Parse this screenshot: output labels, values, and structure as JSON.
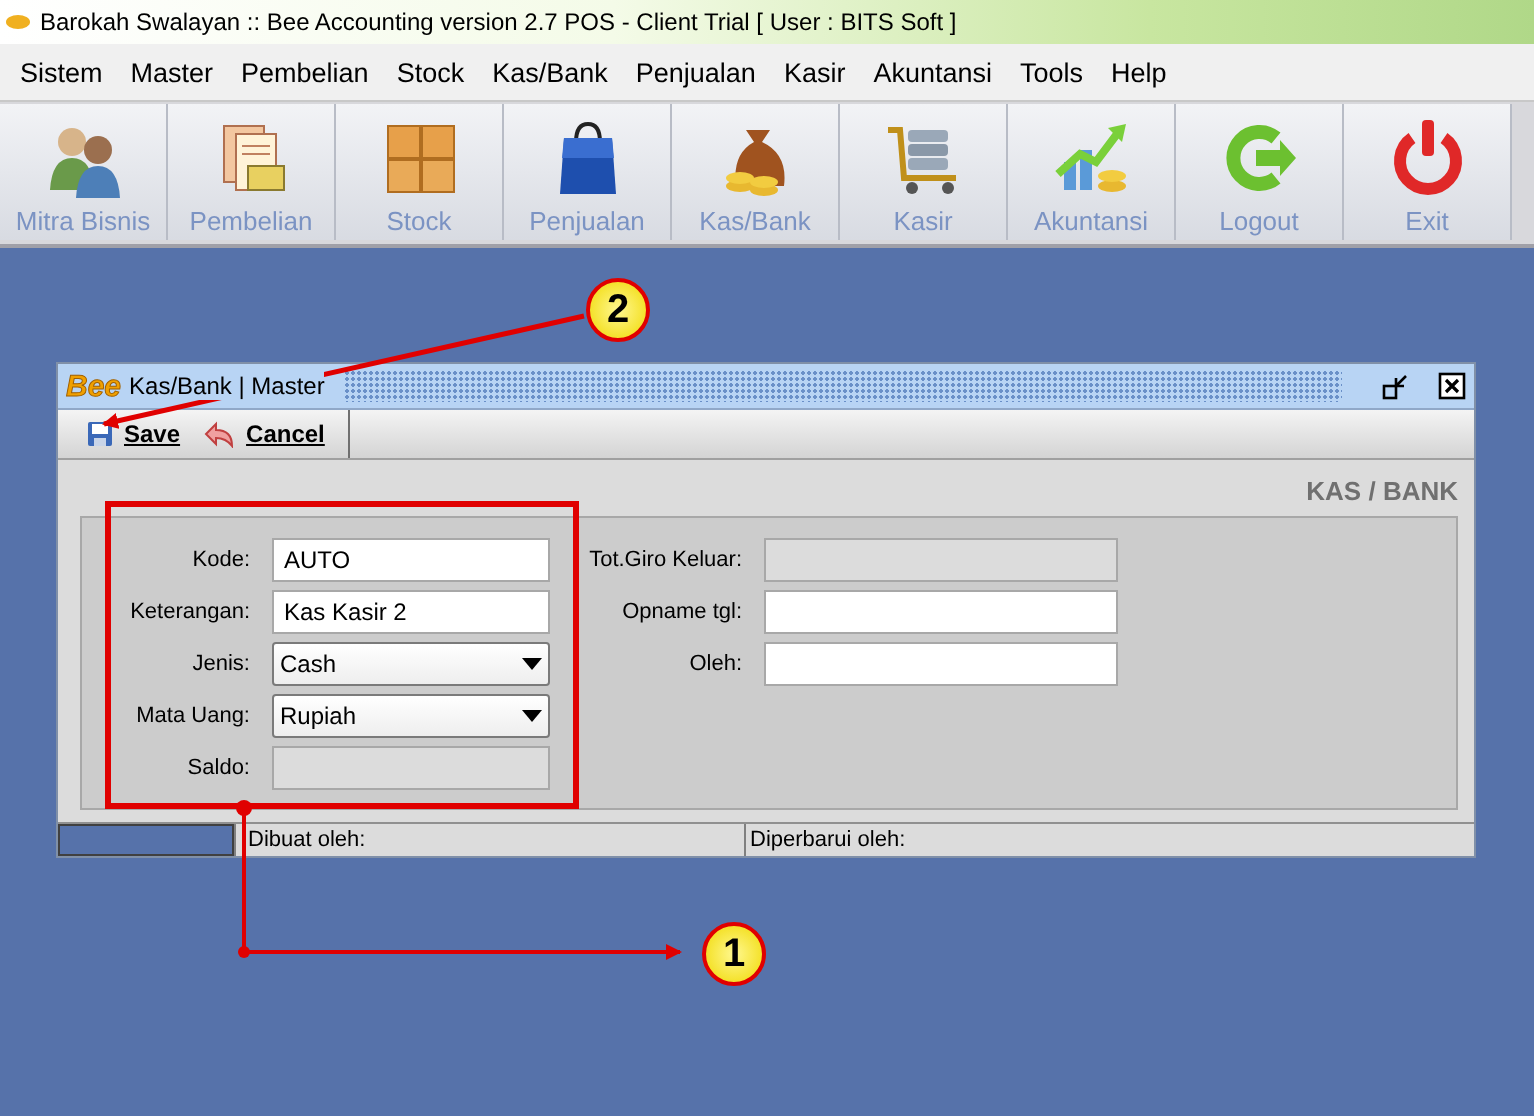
{
  "window": {
    "title": "Barokah Swalayan :: Bee Accounting version 2.7 POS - Client Trial [ User : BITS Soft ]"
  },
  "menu": [
    "Sistem",
    "Master",
    "Pembelian",
    "Stock",
    "Kas/Bank",
    "Penjualan",
    "Kasir",
    "Akuntansi",
    "Tools",
    "Help"
  ],
  "toolbar": [
    {
      "label": "Mitra Bisnis",
      "kind": "people"
    },
    {
      "label": "Pembelian",
      "kind": "documents"
    },
    {
      "label": "Stock",
      "kind": "boxes"
    },
    {
      "label": "Penjualan",
      "kind": "bag"
    },
    {
      "label": "Kas/Bank",
      "kind": "moneybag"
    },
    {
      "label": "Kasir",
      "kind": "cart"
    },
    {
      "label": "Akuntansi",
      "kind": "chart"
    },
    {
      "label": "Logout",
      "kind": "logout"
    },
    {
      "label": "Exit",
      "kind": "power"
    }
  ],
  "dialog": {
    "logo": "Bee",
    "title": "Kas/Bank | Master",
    "buttons": [
      {
        "label": "Save",
        "kind": "save"
      },
      {
        "label": "Cancel",
        "kind": "cancel"
      }
    ],
    "heading": "KAS / BANK",
    "fields_left": [
      {
        "label": "Kode:",
        "kind": "text",
        "value": "AUTO",
        "disabled": false
      },
      {
        "label": "Keterangan:",
        "kind": "text",
        "value": "Kas Kasir 2",
        "disabled": false
      },
      {
        "label": "Jenis:",
        "kind": "dropdown",
        "value": "Cash",
        "disabled": false
      },
      {
        "label": "Mata Uang:",
        "kind": "dropdown",
        "value": "Rupiah",
        "disabled": false
      },
      {
        "label": "Saldo:",
        "kind": "text",
        "disabled": true
      }
    ],
    "fields_right": [
      {
        "label": "Tot.Giro Keluar:",
        "disabled": true
      },
      {
        "label": "Opname tgl:",
        "disabled": false
      },
      {
        "label": "Oleh:",
        "disabled": false
      }
    ],
    "status_bar": [
      "Dibuat oleh:",
      "Diperbarui oleh:"
    ]
  },
  "callouts": [
    "1",
    "2"
  ]
}
